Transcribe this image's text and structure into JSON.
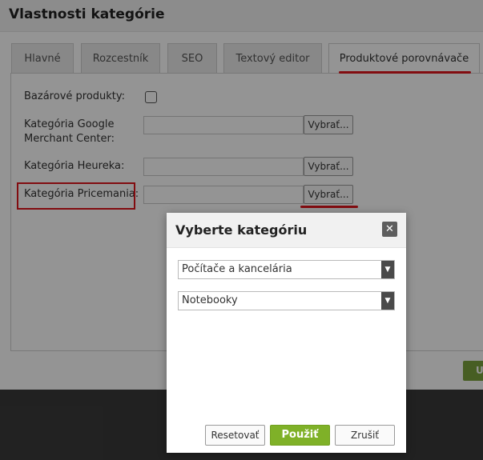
{
  "header": {
    "title": "Vlastnosti kategórie"
  },
  "tabs": [
    {
      "label": "Hlavné"
    },
    {
      "label": "Rozcestník"
    },
    {
      "label": "SEO"
    },
    {
      "label": "Textový editor"
    },
    {
      "label": "Produktové porovnávače"
    }
  ],
  "form": {
    "bazar_label": "Bazárové produkty:",
    "google_label_1": "Kategória Google",
    "google_label_2": "Merchant Center:",
    "heureka_label": "Kategória Heureka:",
    "pricemania_label": "Kategória Pricemania:",
    "choose_label": "Vybrať..."
  },
  "background_button": {
    "label": "U"
  },
  "modal": {
    "title": "Vyberte kategóriu",
    "close_symbol": "✕",
    "select1": "Počítače a kancelária",
    "select2": "Notebooky",
    "reset_label": "Resetovať",
    "apply_label": "Použiť",
    "cancel_label": "Zrušiť"
  },
  "colors": {
    "highlight": "#e0151c",
    "primary_button": "#7fb128"
  },
  "icons": {
    "close": "close-icon",
    "dropdown": "chevron-down-icon"
  }
}
